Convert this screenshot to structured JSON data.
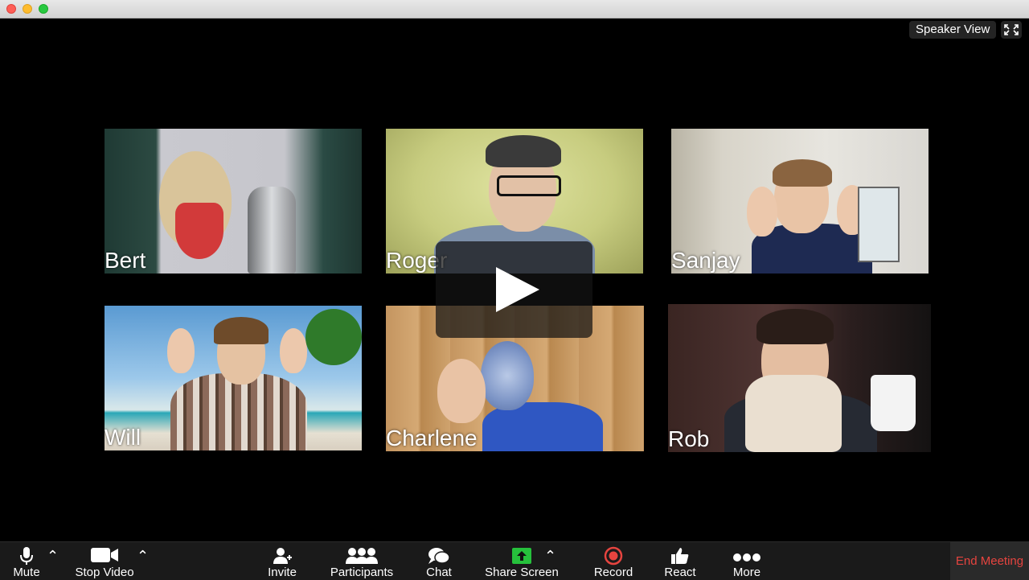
{
  "window": {
    "traffic_lights": [
      "close",
      "minimize",
      "zoom"
    ]
  },
  "view_controls": {
    "speaker_view_label": "Speaker View",
    "fullscreen_icon": "fullscreen-icon"
  },
  "participants": [
    {
      "name": "Bert"
    },
    {
      "name": "Roger"
    },
    {
      "name": "Sanjay"
    },
    {
      "name": "Will"
    },
    {
      "name": "Charlene"
    },
    {
      "name": "Rob"
    }
  ],
  "toolbar": {
    "mute_label": "Mute",
    "stop_video_label": "Stop Video",
    "invite_label": "Invite",
    "participants_label": "Participants",
    "chat_label": "Chat",
    "share_screen_label": "Share Screen",
    "record_label": "Record",
    "react_label": "React",
    "more_label": "More",
    "end_meeting_label": "End Meeting"
  },
  "colors": {
    "end_meeting": "#e6443f",
    "share_screen": "#26c13c",
    "record": "#e6443f",
    "toolbar_bg": "#1a1a1a"
  }
}
